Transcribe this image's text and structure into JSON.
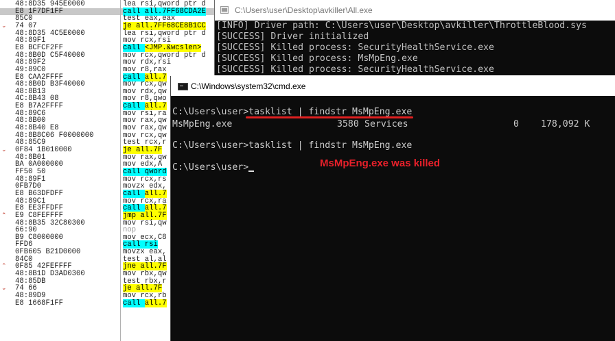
{
  "debugger": {
    "rows": [
      {
        "mark": "",
        "hex": "48:8D35 945E0000",
        "asm": [
          {
            "t": "lea rsi,qword ptr d"
          }
        ],
        "sel": false
      },
      {
        "mark": "",
        "hex": "E8 1F7DF1FF",
        "asm": [
          {
            "t": "call ",
            "s": "ca"
          },
          {
            "t": "all.7FF68CDA2E",
            "s": "ca"
          }
        ],
        "sel": true
      },
      {
        "mark": "",
        "hex": "85C0",
        "asm": [
          {
            "t": "test eax,eax"
          }
        ],
        "sel": false
      },
      {
        "mark": "v",
        "hex": "74 07",
        "asm": [
          {
            "t": "je all.7FF68CE8B1CC",
            "s": "hl"
          }
        ],
        "sel": false
      },
      {
        "mark": "",
        "hex": "48:8D35 4C5E0000",
        "asm": [
          {
            "t": "lea rsi,qword ptr d"
          }
        ],
        "sel": false
      },
      {
        "mark": "",
        "hex": "48:89F1",
        "asm": [
          {
            "t": "mov rcx,rsi"
          }
        ],
        "sel": false
      },
      {
        "mark": "",
        "hex": "E8 BCFCF2FF",
        "asm": [
          {
            "t": "call ",
            "s": "ca"
          },
          {
            "t": "<JMP.&wcslen>",
            "s": "hl"
          }
        ],
        "sel": false
      },
      {
        "mark": "",
        "hex": "48:8B0D C5F40000",
        "asm": [
          {
            "t": "mov rcx,qword ptr d"
          }
        ],
        "sel": false
      },
      {
        "mark": "",
        "hex": "48:89F2",
        "asm": [
          {
            "t": "mov rdx,rsi"
          }
        ],
        "sel": false
      },
      {
        "mark": "",
        "hex": "49:89C0",
        "asm": [
          {
            "t": "mov r8,rax"
          }
        ],
        "sel": false
      },
      {
        "mark": "",
        "hex": "E8 CAA2FFFF",
        "asm": [
          {
            "t": "call ",
            "s": "ca"
          },
          {
            "t": "all.7",
            "s": "hl"
          }
        ],
        "sel": false
      },
      {
        "mark": "",
        "hex": "48:8B0D B3F40000",
        "asm": [
          {
            "t": "mov rcx,qw"
          }
        ],
        "sel": false
      },
      {
        "mark": "",
        "hex": "48:8B13",
        "asm": [
          {
            "t": "mov rdx,qw"
          }
        ],
        "sel": false
      },
      {
        "mark": "",
        "hex": "4C:8B43 08",
        "asm": [
          {
            "t": "mov r8,qwo"
          }
        ],
        "sel": false
      },
      {
        "mark": "",
        "hex": "E8 B7A2FFFF",
        "asm": [
          {
            "t": "call ",
            "s": "ca"
          },
          {
            "t": "all.7",
            "s": "hl"
          }
        ],
        "sel": false
      },
      {
        "mark": "",
        "hex": "48:89C6",
        "asm": [
          {
            "t": "mov rsi,ra"
          }
        ],
        "sel": false
      },
      {
        "mark": "",
        "hex": "48:8B00",
        "asm": [
          {
            "t": "mov rax,qw"
          }
        ],
        "sel": false
      },
      {
        "mark": "",
        "hex": "48:8B40 E8",
        "asm": [
          {
            "t": "mov rax,qw"
          }
        ],
        "sel": false
      },
      {
        "mark": "",
        "hex": "48:8B8C06 F0000000",
        "asm": [
          {
            "t": "mov rcx,qw"
          }
        ],
        "sel": false
      },
      {
        "mark": "",
        "hex": "48:85C9",
        "asm": [
          {
            "t": "test rcx,r"
          }
        ],
        "sel": false
      },
      {
        "mark": "v",
        "hex": "0F84 1B010000",
        "asm": [
          {
            "t": "je all.7F",
            "s": "hl"
          }
        ],
        "sel": false
      },
      {
        "mark": "",
        "hex": "48:8B01",
        "asm": [
          {
            "t": "mov rax,qw"
          }
        ],
        "sel": false
      },
      {
        "mark": "",
        "hex": "BA 0A000000",
        "asm": [
          {
            "t": "mov edx,A"
          }
        ],
        "sel": false
      },
      {
        "mark": "",
        "hex": "FF50 50",
        "asm": [
          {
            "t": "call ",
            "s": "ca"
          },
          {
            "t": "qword",
            "s": "ca"
          }
        ],
        "sel": false
      },
      {
        "mark": "",
        "hex": "48:89F1",
        "asm": [
          {
            "t": "mov rcx,rs"
          }
        ],
        "sel": false
      },
      {
        "mark": "",
        "hex": "0FB7D0",
        "asm": [
          {
            "t": "movzx edx,"
          }
        ],
        "sel": false
      },
      {
        "mark": "",
        "hex": "E8 B63DFDFF",
        "asm": [
          {
            "t": "call ",
            "s": "ca"
          },
          {
            "t": "all.7",
            "s": "hl"
          }
        ],
        "sel": false
      },
      {
        "mark": "",
        "hex": "48:89C1",
        "asm": [
          {
            "t": "mov rcx,ra"
          }
        ],
        "sel": false
      },
      {
        "mark": "",
        "hex": "E8 EE3FFDFF",
        "asm": [
          {
            "t": "call ",
            "s": "ca"
          },
          {
            "t": "all.7",
            "s": "hl"
          }
        ],
        "sel": false
      },
      {
        "mark": "^",
        "hex": "E9 C8FEFFFF",
        "asm": [
          {
            "t": "jmp all.7F",
            "s": "hl"
          }
        ],
        "sel": false
      },
      {
        "mark": "",
        "hex": "48:8B35 32C80300",
        "asm": [
          {
            "t": "mov rsi,qw"
          }
        ],
        "sel": false
      },
      {
        "mark": "",
        "hex": "66:90",
        "asm": [
          {
            "t": "nop",
            "s": "gray"
          }
        ],
        "sel": false
      },
      {
        "mark": "",
        "hex": "B9 C8000000",
        "asm": [
          {
            "t": "mov ecx,C8"
          }
        ],
        "sel": false
      },
      {
        "mark": "",
        "hex": "FFD6",
        "asm": [
          {
            "t": "call ",
            "s": "ca"
          },
          {
            "t": "rsi",
            "s": "ca"
          }
        ],
        "sel": false
      },
      {
        "mark": "",
        "hex": "0FB605 B21D0000",
        "asm": [
          {
            "t": "movzx eax,"
          }
        ],
        "sel": false
      },
      {
        "mark": "",
        "hex": "84C0",
        "asm": [
          {
            "t": "test al,al"
          }
        ],
        "sel": false
      },
      {
        "mark": "^",
        "hex": "0F85 42FEFFFF",
        "asm": [
          {
            "t": "jne all.7F",
            "s": "hl"
          }
        ],
        "sel": false
      },
      {
        "mark": "",
        "hex": "48:8B1D D3AD0300",
        "asm": [
          {
            "t": "mov rbx,qw"
          }
        ],
        "sel": false
      },
      {
        "mark": "",
        "hex": "48:85DB",
        "asm": [
          {
            "t": "test rbx,r"
          }
        ],
        "sel": false
      },
      {
        "mark": "v",
        "hex": "74 66",
        "asm": [
          {
            "t": "je all.7F",
            "s": "hl"
          }
        ],
        "sel": false
      },
      {
        "mark": "",
        "hex": "48:89D9",
        "asm": [
          {
            "t": "mov rcx,rb"
          }
        ],
        "sel": false
      },
      {
        "mark": "",
        "hex": "E8 1668F1FF",
        "asm": [
          {
            "t": "call ",
            "s": "ca"
          },
          {
            "t": "all.7",
            "s": "hl"
          }
        ],
        "sel": false
      }
    ]
  },
  "all_window": {
    "title": "C:\\Users\\user\\Desktop\\avkiller\\All.exe",
    "lines": [
      "[INFO] Driver path: C:\\Users\\user\\Desktop\\avkiller\\ThrottleBlood.sys",
      "[SUCCESS] Driver initialized",
      "[SUCCESS] Killed process: SecurityHealthService.exe",
      "[SUCCESS] Killed process: MsMpEng.exe",
      "[SUCCESS] Killed process: SecurityHealthService.exe"
    ]
  },
  "cmd_window": {
    "title": "C:\\Windows\\system32\\cmd.exe",
    "prompt1": "C:\\Users\\user>",
    "command1": "tasklist | findstr MsMpEng.exe",
    "result": {
      "image": "MsMpEng.exe",
      "pid": "3580",
      "session": "Services",
      "session_num": "0",
      "mem": "178,092 K"
    },
    "prompt2": "C:\\Users\\user>",
    "command2": "tasklist | findstr MsMpEng.exe",
    "prompt3": "C:\\Users\\user>"
  },
  "annotation": {
    "text": "MsMpEng.exe was killed",
    "color": "#e8202a"
  }
}
